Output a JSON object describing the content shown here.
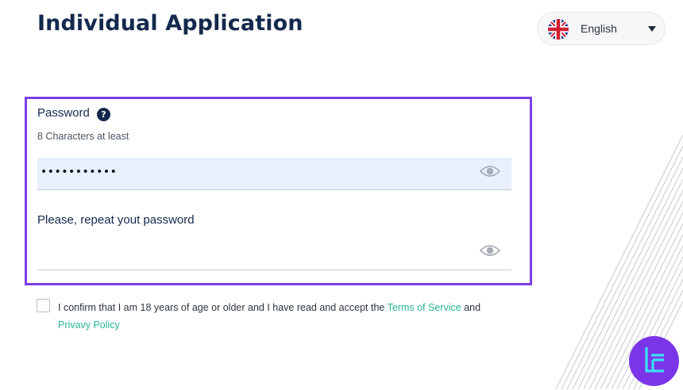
{
  "page": {
    "title": "Individual Application"
  },
  "language": {
    "selected": "English",
    "flag_icon": "uk-flag-icon"
  },
  "password": {
    "label": "Password",
    "help_icon": "?",
    "hint": "8 Characters at least",
    "masked_value": "•••••••••••"
  },
  "repeat_password": {
    "label": "Please, repeat yout password",
    "value": ""
  },
  "consent": {
    "text_before": "I confirm that I am 18 years of age or older and I have read and accept the",
    "terms_link": "Terms of Service",
    "and": "and",
    "privacy_link": "Privavy Policy",
    "checked": false
  },
  "colors": {
    "accent_purple": "#7b3fe4",
    "link_green": "#27b58f",
    "title_navy": "#14294d",
    "input_fill": "#e8f0fe"
  }
}
